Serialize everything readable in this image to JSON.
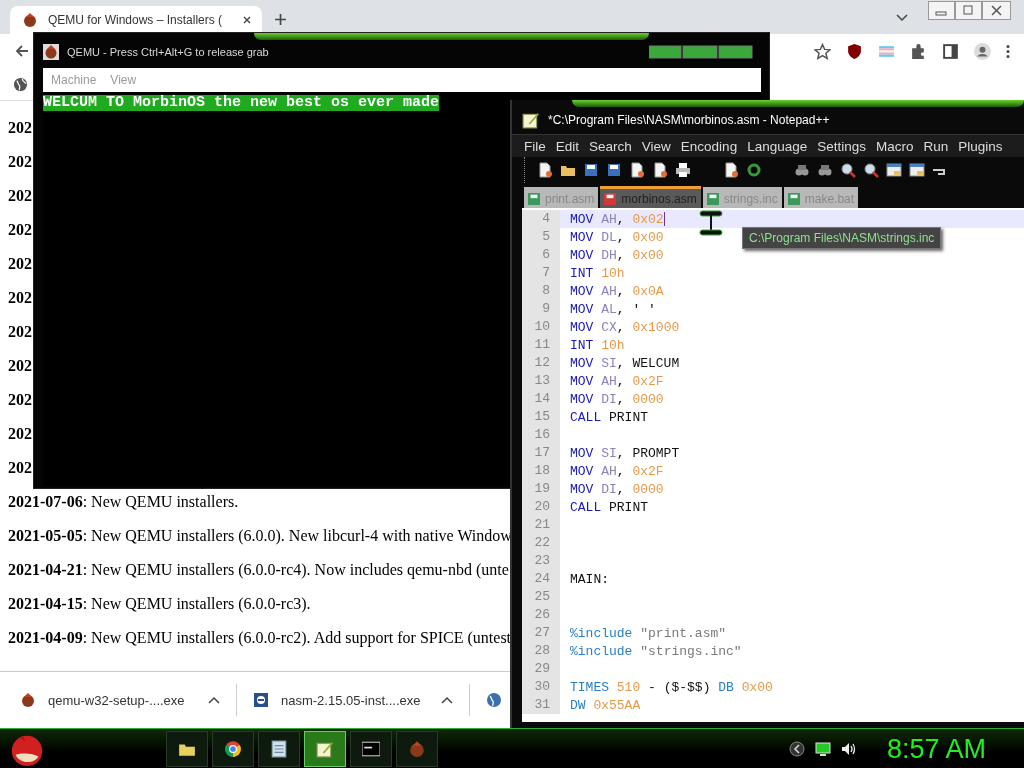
{
  "browser": {
    "tab": {
      "title": "QEMU for Windows – Installers ("
    },
    "page_lines": [
      {
        "date": "202"
      },
      {
        "date": "202"
      },
      {
        "date": "202"
      },
      {
        "date": "202"
      },
      {
        "date": "202"
      },
      {
        "date": "202"
      },
      {
        "date": "202"
      },
      {
        "date": "202"
      },
      {
        "date": "202"
      },
      {
        "date": "202"
      },
      {
        "date": "202"
      },
      {
        "date": "2021-07-06",
        "text": ": New QEMU installers."
      },
      {
        "date": "2021-05-05",
        "text": ": New QEMU installers (6.0.0). New libcurl-4 with native Window"
      },
      {
        "date": "2021-04-21",
        "text": ": New QEMU installers (6.0.0-rc4). Now includes qemu-nbd (unte"
      },
      {
        "date": "2021-04-15",
        "text": ": New QEMU installers (6.0.0-rc3)."
      },
      {
        "date": "2021-04-09",
        "text": ": New QEMU installers (6.0.0-rc2). Add support for SPICE (untest"
      }
    ],
    "downloads": [
      {
        "name": "qemu-w32-setup-....exe",
        "kind": "qemu"
      },
      {
        "name": "nasm-2.15.05-inst....exe",
        "kind": "installer"
      }
    ]
  },
  "qemu": {
    "title": "QEMU - Press Ctrl+Alt+G to release grab",
    "menus": [
      "Machine",
      "View"
    ],
    "screen_text": "WELCUM TO MorbinOS the new best os ever made"
  },
  "notepad": {
    "title": "*C:\\Program Files\\NASM\\morbinos.asm - Notepad++",
    "menus": [
      "File",
      "Edit",
      "Search",
      "View",
      "Encoding",
      "Language",
      "Settings",
      "Macro",
      "Run",
      "Plugins"
    ],
    "tabs": [
      {
        "label": "print.asm",
        "selected": false,
        "modified": false
      },
      {
        "label": "morbinos.asm",
        "selected": true,
        "modified": true
      },
      {
        "label": "strings.inc",
        "selected": false,
        "modified": false
      },
      {
        "label": "make.bat",
        "selected": false,
        "modified": false
      }
    ],
    "lines": [
      {
        "n": "4",
        "current": true,
        "tokens": [
          {
            "kind": "instr",
            "text": "MOV"
          },
          {
            "kind": "reg",
            "text": " AH"
          },
          {
            "kind": "plain",
            "text": ", "
          },
          {
            "kind": "num",
            "text": "0x02"
          }
        ]
      },
      {
        "n": "5",
        "current": false,
        "tokens": [
          {
            "kind": "instr",
            "text": "MOV"
          },
          {
            "kind": "reg",
            "text": " DL"
          },
          {
            "kind": "plain",
            "text": ", "
          },
          {
            "kind": "num",
            "text": "0x00"
          }
        ]
      },
      {
        "n": "6",
        "current": false,
        "tokens": [
          {
            "kind": "instr",
            "text": "MOV"
          },
          {
            "kind": "reg",
            "text": " DH"
          },
          {
            "kind": "plain",
            "text": ", "
          },
          {
            "kind": "num",
            "text": "0x00"
          }
        ]
      },
      {
        "n": "7",
        "current": false,
        "tokens": [
          {
            "kind": "instr",
            "text": "INT"
          },
          {
            "kind": "num",
            "text": " 10h"
          }
        ]
      },
      {
        "n": "8",
        "current": false,
        "tokens": [
          {
            "kind": "instr",
            "text": "MOV"
          },
          {
            "kind": "reg",
            "text": " AH"
          },
          {
            "kind": "plain",
            "text": ", "
          },
          {
            "kind": "num",
            "text": "0x0A"
          }
        ]
      },
      {
        "n": "9",
        "current": false,
        "tokens": [
          {
            "kind": "instr",
            "text": "MOV"
          },
          {
            "kind": "reg",
            "text": " AL"
          },
          {
            "kind": "plain",
            "text": ", ' '"
          }
        ]
      },
      {
        "n": "10",
        "current": false,
        "tokens": [
          {
            "kind": "instr",
            "text": "MOV"
          },
          {
            "kind": "reg",
            "text": " CX"
          },
          {
            "kind": "plain",
            "text": ", "
          },
          {
            "kind": "num",
            "text": "0x1000"
          }
        ]
      },
      {
        "n": "11",
        "current": false,
        "tokens": [
          {
            "kind": "instr",
            "text": "INT"
          },
          {
            "kind": "num",
            "text": " 10h"
          }
        ]
      },
      {
        "n": "12",
        "current": false,
        "tokens": [
          {
            "kind": "instr",
            "text": "MOV"
          },
          {
            "kind": "reg",
            "text": " SI"
          },
          {
            "kind": "plain",
            "text": ", WELCUM"
          }
        ]
      },
      {
        "n": "13",
        "current": false,
        "tokens": [
          {
            "kind": "instr",
            "text": "MOV"
          },
          {
            "kind": "reg",
            "text": " AH"
          },
          {
            "kind": "plain",
            "text": ", "
          },
          {
            "kind": "num",
            "text": "0x2F"
          }
        ]
      },
      {
        "n": "14",
        "current": false,
        "tokens": [
          {
            "kind": "instr",
            "text": "MOV"
          },
          {
            "kind": "reg",
            "text": " DI"
          },
          {
            "kind": "plain",
            "text": ", "
          },
          {
            "kind": "num",
            "text": "0000"
          }
        ]
      },
      {
        "n": "15",
        "current": false,
        "tokens": [
          {
            "kind": "instr",
            "text": "CALL"
          },
          {
            "kind": "plain",
            "text": " PRINT"
          }
        ]
      },
      {
        "n": "16",
        "current": false
      },
      {
        "n": "17",
        "current": false,
        "tokens": [
          {
            "kind": "instr",
            "text": "MOV"
          },
          {
            "kind": "reg",
            "text": " SI"
          },
          {
            "kind": "plain",
            "text": ", PROMPT"
          }
        ]
      },
      {
        "n": "18",
        "current": false,
        "tokens": [
          {
            "kind": "instr",
            "text": "MOV"
          },
          {
            "kind": "reg",
            "text": " AH"
          },
          {
            "kind": "plain",
            "text": ", "
          },
          {
            "kind": "num",
            "text": "0x2F"
          }
        ]
      },
      {
        "n": "19",
        "current": false,
        "tokens": [
          {
            "kind": "instr",
            "text": "MOV"
          },
          {
            "kind": "reg",
            "text": " DI"
          },
          {
            "kind": "plain",
            "text": ", "
          },
          {
            "kind": "num",
            "text": "0000"
          }
        ]
      },
      {
        "n": "20",
        "current": false,
        "tokens": [
          {
            "kind": "instr",
            "text": "CALL"
          },
          {
            "kind": "plain",
            "text": " PRINT"
          }
        ]
      },
      {
        "n": "21",
        "current": false
      },
      {
        "n": "22",
        "current": false
      },
      {
        "n": "23",
        "current": false
      },
      {
        "n": "24",
        "current": false,
        "tokens": [
          {
            "kind": "plain",
            "text": "MAIN:"
          }
        ]
      },
      {
        "n": "25",
        "current": false
      },
      {
        "n": "26",
        "current": false
      },
      {
        "n": "27",
        "current": false,
        "tokens": [
          {
            "kind": "dir",
            "text": "%include"
          },
          {
            "kind": "str",
            "text": " \"print.asm\""
          }
        ]
      },
      {
        "n": "28",
        "current": false,
        "tokens": [
          {
            "kind": "dir",
            "text": "%include"
          },
          {
            "kind": "str",
            "text": " \"strings.inc\""
          }
        ]
      },
      {
        "n": "29",
        "current": false
      },
      {
        "n": "30",
        "current": false,
        "tokens": [
          {
            "kind": "dir",
            "text": "TIMES"
          },
          {
            "kind": "num",
            "text": " 510"
          },
          {
            "kind": "plain",
            "text": " - ($-$$) "
          },
          {
            "kind": "dir",
            "text": "DB"
          },
          {
            "kind": "num",
            "text": " 0x00"
          }
        ]
      },
      {
        "n": "31",
        "current": false,
        "tokens": [
          {
            "kind": "dir",
            "text": "DW"
          },
          {
            "kind": "num",
            "text": " 0x55AA"
          }
        ]
      }
    ],
    "tooltip": "C:\\Program Files\\NASM\\strings.inc"
  },
  "taskbar": {
    "apps": [
      {
        "kind": "folder",
        "selected": false
      },
      {
        "kind": "browser",
        "selected": false
      },
      {
        "kind": "notes",
        "selected": false
      },
      {
        "kind": "notepad",
        "selected": true
      },
      {
        "kind": "console",
        "selected": false
      },
      {
        "kind": "qemu",
        "selected": false
      }
    ],
    "clock": "8:57 AM"
  }
}
